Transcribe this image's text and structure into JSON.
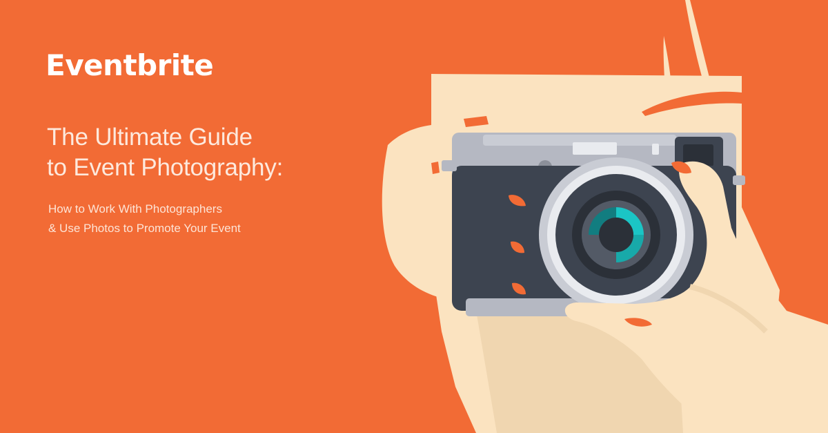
{
  "brand": {
    "name": "Eventbrite"
  },
  "headline": {
    "line1": "The Ultimate Guide",
    "line2": "to Event Photography:"
  },
  "subheadline": {
    "line1": "How to Work With Photographers",
    "line2": "& Use Photos to Promote Your Event"
  },
  "colors": {
    "background": "#f26b35",
    "skin": "#fbe3c0",
    "camera_body": "#3d4450",
    "camera_top": "#b5b8c2",
    "lens_accent": "#1bc5c5",
    "nail": "#f26b35"
  },
  "illustration": {
    "icon": "camera-icon"
  }
}
